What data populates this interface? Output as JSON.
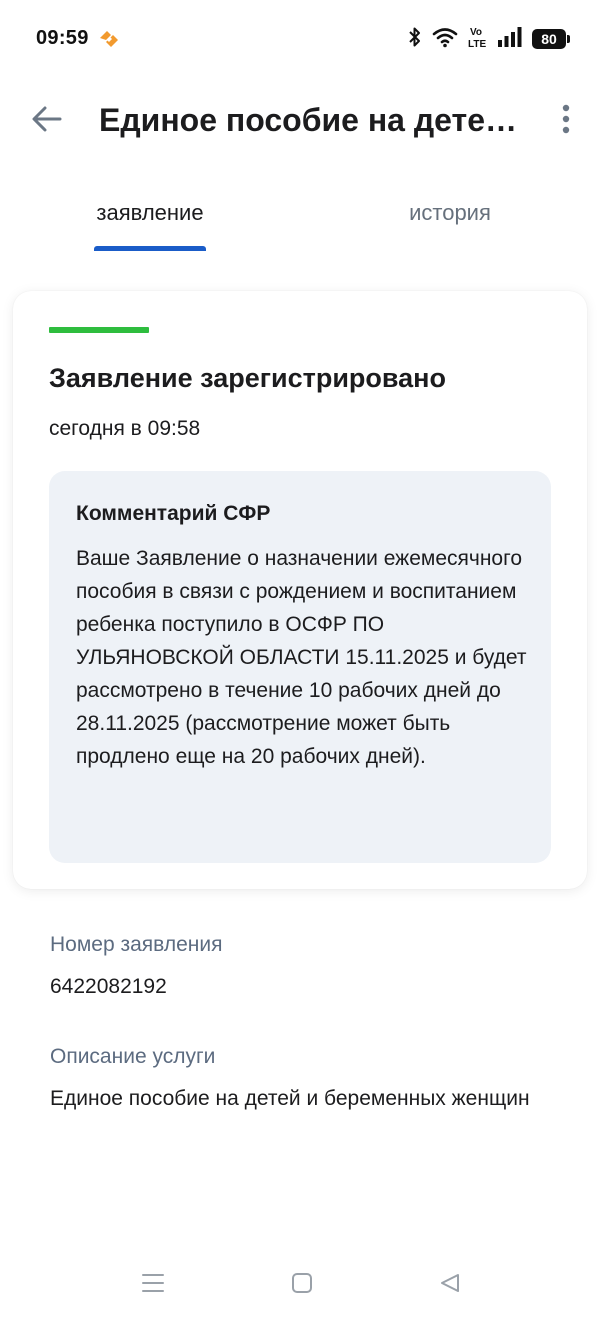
{
  "status_bar": {
    "time": "09:59",
    "battery": "80",
    "icons": [
      "app-notification-icon",
      "bluetooth-icon",
      "wifi-icon",
      "volte-icon",
      "signal-icon",
      "battery-icon"
    ]
  },
  "header": {
    "title": "Единое пособие на детей и беременных женщин",
    "back_icon": "arrow-left-icon",
    "more_icon": "more-vertical-icon"
  },
  "tabs": [
    {
      "label": "заявление",
      "active": true
    },
    {
      "label": "история",
      "active": false
    }
  ],
  "status_card": {
    "title": "Заявление зарегистрировано",
    "date": "сегодня в 09:58",
    "status_color": "#2ebd3e",
    "comment": {
      "title": "Комментарий СФР",
      "text": "Ваше Заявление о назначении ежемесячного пособия в связи с рождением и воспитанием ребенка поступило в ОСФР ПО УЛЬЯНОВСКОЙ ОБЛАСТИ 15.11.2025 и будет рассмотрено в течение 10 рабочих дней до 28.11.2025 (рассмотрение может быть продлено еще на 20 рабочих дней)."
    }
  },
  "details": {
    "number_label": "Номер заявления",
    "number_value": "6422082192",
    "description_label": "Описание услуги",
    "description_value": "Единое пособие на детей и беременных женщин"
  },
  "nav_bar": {
    "icons": [
      "menu-icon",
      "home-icon",
      "back-icon"
    ]
  },
  "colors": {
    "accent": "#1a5cc8",
    "success": "#2ebd3e",
    "comment_bg": "#eef2f7",
    "label": "#5c6b80"
  }
}
